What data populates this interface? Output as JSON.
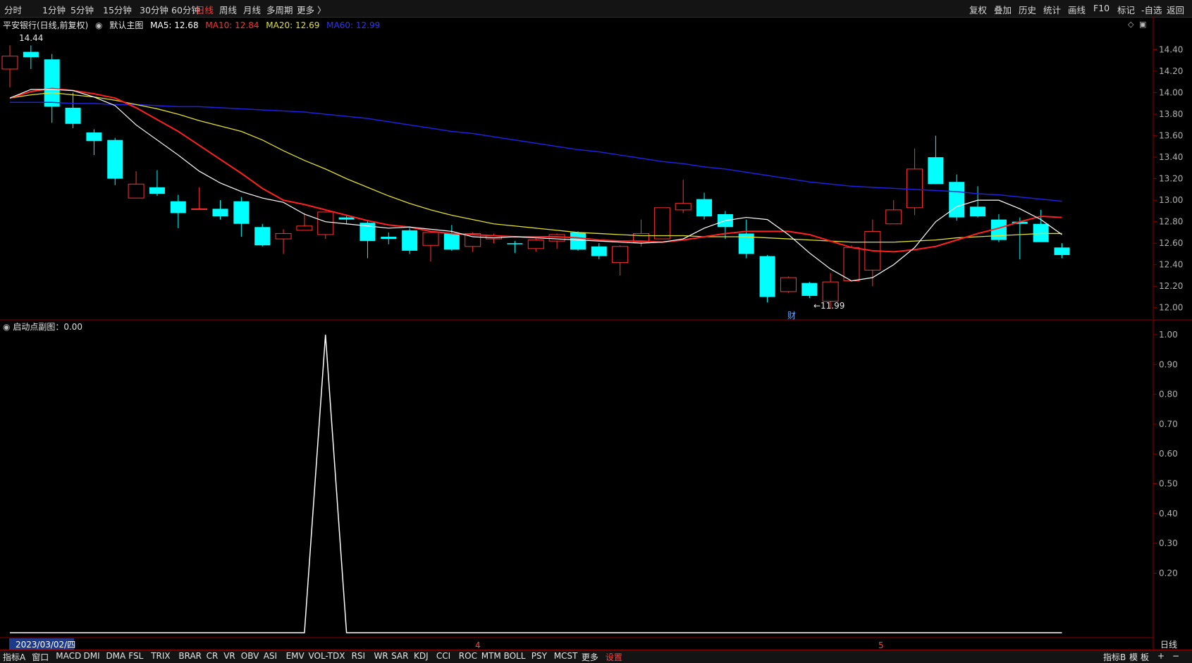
{
  "toolbar": {
    "periods": [
      "分时",
      "1分钟",
      "5分钟",
      "15分钟",
      "30分钟",
      "60分钟",
      "日线",
      "周线",
      "月线",
      "多周期",
      "更多 〉"
    ],
    "active_period": "日线",
    "right_buttons": [
      "复权",
      "叠加",
      "历史",
      "统计",
      "画线",
      "F10",
      "标记",
      "-自选",
      "返回"
    ]
  },
  "legend": {
    "title": "平安银行(日线,前复权)",
    "main_label": "默认主图",
    "ma5": "MA5: 12.68",
    "ma10": "MA10: 12.84",
    "ma20": "MA20: 12.69",
    "ma60": "MA60: 12.99"
  },
  "annotations": {
    "high": "14.44",
    "low": "←11.99",
    "fin_marker": "财"
  },
  "sub_legend": {
    "title": "启动点副图：0.00"
  },
  "axis_labels": {
    "date_box": "2023/03/02/四",
    "month4": "4",
    "month5": "5",
    "right_bottom": "日线"
  },
  "bottom_tabs": [
    "指标A",
    "窗口",
    "MACD",
    "DMI",
    "DMA",
    "FSL",
    "TRIX",
    "BRAR",
    "CR",
    "VR",
    "OBV",
    "ASI",
    "EMV",
    "VOL-TDX",
    "RSI",
    "WR",
    "SAR",
    "KDJ",
    "CCI",
    "ROC",
    "MTM",
    "BOLL",
    "PSY",
    "MCST",
    "更多",
    "设置"
  ],
  "bottom_right": [
    "指标B",
    "模",
    "板",
    "+",
    "−"
  ],
  "colors": {
    "up": "#ff3232",
    "down": "#00ffff",
    "ma5": "#ffffff",
    "ma10": "#ff2020",
    "ma20": "#e0e030",
    "ma60": "#2020e0"
  },
  "chart_data": [
    {
      "type": "candlestick",
      "ylim": [
        11.9,
        14.6
      ],
      "y_ticks": [
        12.0,
        12.2,
        12.4,
        12.6,
        12.8,
        13.0,
        13.2,
        13.4,
        13.6,
        13.8,
        14.0,
        14.2,
        14.4
      ],
      "ohlc": [
        [
          14.22,
          14.44,
          14.05,
          14.34
        ],
        [
          14.38,
          14.44,
          14.22,
          14.33
        ],
        [
          14.31,
          14.36,
          13.72,
          13.87
        ],
        [
          13.86,
          14.0,
          13.67,
          13.71
        ],
        [
          13.63,
          13.66,
          13.42,
          13.55
        ],
        [
          13.56,
          13.58,
          13.14,
          13.2
        ],
        [
          13.02,
          13.27,
          13.02,
          13.15
        ],
        [
          13.12,
          13.28,
          13.04,
          13.06
        ],
        [
          12.99,
          13.05,
          12.74,
          12.88
        ],
        [
          12.92,
          13.12,
          12.92,
          12.92
        ],
        [
          12.92,
          13.0,
          12.82,
          12.85
        ],
        [
          12.99,
          13.03,
          12.66,
          12.78
        ],
        [
          12.75,
          12.78,
          12.57,
          12.58
        ],
        [
          12.64,
          12.73,
          12.5,
          12.69
        ],
        [
          12.72,
          12.88,
          12.72,
          12.76
        ],
        [
          12.68,
          12.89,
          12.64,
          12.89
        ],
        [
          12.84,
          12.86,
          12.78,
          12.82
        ],
        [
          12.79,
          12.81,
          12.46,
          12.62
        ],
        [
          12.66,
          12.7,
          12.59,
          12.64
        ],
        [
          12.72,
          12.74,
          12.5,
          12.53
        ],
        [
          12.58,
          12.7,
          12.43,
          12.7
        ],
        [
          12.69,
          12.77,
          12.53,
          12.54
        ],
        [
          12.57,
          12.7,
          12.52,
          12.69
        ],
        [
          12.64,
          12.69,
          12.6,
          12.67
        ],
        [
          12.6,
          12.62,
          12.51,
          12.59
        ],
        [
          12.55,
          12.66,
          12.52,
          12.63
        ],
        [
          12.62,
          12.69,
          12.55,
          12.68
        ],
        [
          12.7,
          12.71,
          12.53,
          12.54
        ],
        [
          12.57,
          12.6,
          12.45,
          12.48
        ],
        [
          12.42,
          12.58,
          12.3,
          12.57
        ],
        [
          12.61,
          12.82,
          12.57,
          12.69
        ],
        [
          12.64,
          12.93,
          12.64,
          12.93
        ],
        [
          12.91,
          13.19,
          12.88,
          12.97
        ],
        [
          13.01,
          13.07,
          12.82,
          12.85
        ],
        [
          12.87,
          12.9,
          12.64,
          12.75
        ],
        [
          12.69,
          12.82,
          12.46,
          12.5
        ],
        [
          12.48,
          12.49,
          12.05,
          12.1
        ],
        [
          12.15,
          12.29,
          12.14,
          12.28
        ],
        [
          12.23,
          12.24,
          12.09,
          12.11
        ],
        [
          12.06,
          12.32,
          11.99,
          12.24
        ],
        [
          12.25,
          12.58,
          12.24,
          12.56
        ],
        [
          12.35,
          12.82,
          12.2,
          12.71
        ],
        [
          12.78,
          13.0,
          12.78,
          12.91
        ],
        [
          12.93,
          13.48,
          12.86,
          13.29
        ],
        [
          13.4,
          13.6,
          13.15,
          13.15
        ],
        [
          13.17,
          13.24,
          12.81,
          12.84
        ],
        [
          12.94,
          13.13,
          12.84,
          12.85
        ],
        [
          12.82,
          12.87,
          12.61,
          12.63
        ],
        [
          12.8,
          12.84,
          12.45,
          12.78
        ],
        [
          12.78,
          12.91,
          12.63,
          12.61
        ],
        [
          12.56,
          12.6,
          12.46,
          12.49
        ]
      ],
      "ma5": [
        13.95,
        14.03,
        14.03,
        14.02,
        13.96,
        13.88,
        13.7,
        13.56,
        13.42,
        13.27,
        13.16,
        13.08,
        13.02,
        12.98,
        12.87,
        12.8,
        12.78,
        12.76,
        12.74,
        12.75,
        12.73,
        12.71,
        12.66,
        12.65,
        12.66,
        12.65,
        12.64,
        12.63,
        12.62,
        12.61,
        12.6,
        12.61,
        12.64,
        12.74,
        12.81,
        12.84,
        12.82,
        12.68,
        12.51,
        12.36,
        12.25,
        12.28,
        12.4,
        12.56,
        12.8,
        12.94,
        13.0,
        13.0,
        12.92,
        12.82,
        12.68
      ],
      "ma10": [
        13.95,
        14.01,
        14.04,
        14.02,
        13.99,
        13.95,
        13.86,
        13.75,
        13.64,
        13.51,
        13.38,
        13.25,
        13.11,
        13.0,
        12.96,
        12.91,
        12.86,
        12.81,
        12.77,
        12.75,
        12.71,
        12.69,
        12.68,
        12.67,
        12.66,
        12.66,
        12.66,
        12.65,
        12.63,
        12.62,
        12.62,
        12.61,
        12.63,
        12.66,
        12.69,
        12.71,
        12.71,
        12.71,
        12.68,
        12.62,
        12.56,
        12.53,
        12.52,
        12.54,
        12.57,
        12.63,
        12.69,
        12.74,
        12.8,
        12.85,
        12.84
      ],
      "ma20": [
        13.95,
        13.98,
        14.0,
        13.98,
        13.96,
        13.93,
        13.89,
        13.85,
        13.8,
        13.74,
        13.69,
        13.64,
        13.56,
        13.46,
        13.37,
        13.29,
        13.2,
        13.12,
        13.04,
        12.97,
        12.91,
        12.86,
        12.82,
        12.78,
        12.76,
        12.74,
        12.72,
        12.7,
        12.69,
        12.68,
        12.67,
        12.67,
        12.67,
        12.66,
        12.66,
        12.66,
        12.65,
        12.64,
        12.63,
        12.62,
        12.61,
        12.61,
        12.61,
        12.62,
        12.63,
        12.65,
        12.66,
        12.67,
        12.68,
        12.69,
        12.69
      ],
      "ma60": [
        13.91,
        13.91,
        13.91,
        13.9,
        13.9,
        13.89,
        13.89,
        13.88,
        13.87,
        13.87,
        13.86,
        13.85,
        13.84,
        13.83,
        13.82,
        13.8,
        13.78,
        13.76,
        13.73,
        13.7,
        13.67,
        13.64,
        13.62,
        13.59,
        13.56,
        13.53,
        13.5,
        13.47,
        13.45,
        13.42,
        13.39,
        13.36,
        13.34,
        13.31,
        13.29,
        13.26,
        13.23,
        13.2,
        13.17,
        13.15,
        13.13,
        13.12,
        13.11,
        13.1,
        13.09,
        13.08,
        13.06,
        13.05,
        13.03,
        13.01,
        12.99
      ]
    },
    {
      "type": "line",
      "title": "启动点副图",
      "ylim": [
        0,
        1.0
      ],
      "y_ticks": [
        0.2,
        0.3,
        0.4,
        0.5,
        0.6,
        0.7,
        0.8,
        0.9,
        1.0
      ],
      "values": [
        0,
        0,
        0,
        0,
        0,
        0,
        0,
        0,
        0,
        0,
        0,
        0,
        0,
        0,
        0,
        1,
        0,
        0,
        0,
        0,
        0,
        0,
        0,
        0,
        0,
        0,
        0,
        0,
        0,
        0,
        0,
        0,
        0,
        0,
        0,
        0,
        0,
        0,
        0,
        0,
        0,
        0,
        0,
        0,
        0,
        0,
        0,
        0,
        0,
        0,
        0
      ]
    }
  ]
}
